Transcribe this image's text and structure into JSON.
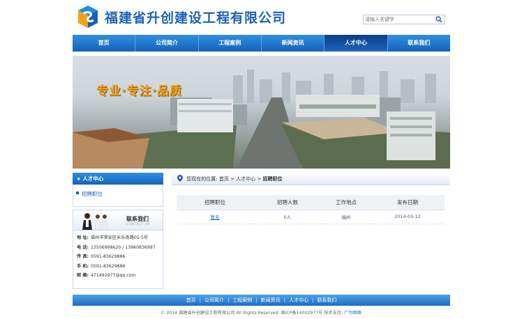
{
  "header": {
    "company_name": "福建省升创建设工程有限公司",
    "search_placeholder": "请输入关键字"
  },
  "nav": {
    "items": [
      "首页",
      "公司简介",
      "工程案例",
      "新闻资讯",
      "人才中心",
      "联系我们"
    ],
    "active": "人才中心"
  },
  "banner": {
    "slogan": "专业·专注·品质"
  },
  "sidebar": {
    "title": "人才中心",
    "links": [
      "招聘职位"
    ],
    "contact_title": "联系我们",
    "contact_sub": "CONTACT US",
    "contact": {
      "address_label": "地 址:",
      "address": "福州市晋安区长乐南路05-5号",
      "phone_label": "电 话:",
      "phone": "13506998620 / 13960836997",
      "fax_label": "传 真:",
      "fax": "0591-83629886",
      "mobile_label": "手 机:",
      "mobile": "0591-83629886",
      "email_label": "邮 箱:",
      "email": "471492977@qq.com"
    }
  },
  "breadcrumb": {
    "prefix": "您现在的位置:",
    "home": "首页",
    "sep1": ">",
    "section": "人才中心",
    "sep2": ">",
    "current": "招聘职位"
  },
  "jobs": {
    "headers": [
      "招聘职位",
      "招聘人数",
      "工作地点",
      "发布日期"
    ],
    "rows": [
      {
        "title": "暂无",
        "count": "0人",
        "location": "福州",
        "date": "2014-03-12"
      }
    ]
  },
  "footer": {
    "nav": [
      "首页",
      "公司简介",
      "工程案例",
      "新闻资讯",
      "人才中心",
      "联系我们"
    ],
    "copyright": "© 2014 福建省升创建设工程有限公司 All Rights Reserved. 闽ICP备14002977号  技术支持:",
    "tech": "广为网络"
  },
  "colors": {
    "brand": "#1e62b4",
    "slogan": "#f4a11a",
    "nav_dark": "#1562b8"
  }
}
